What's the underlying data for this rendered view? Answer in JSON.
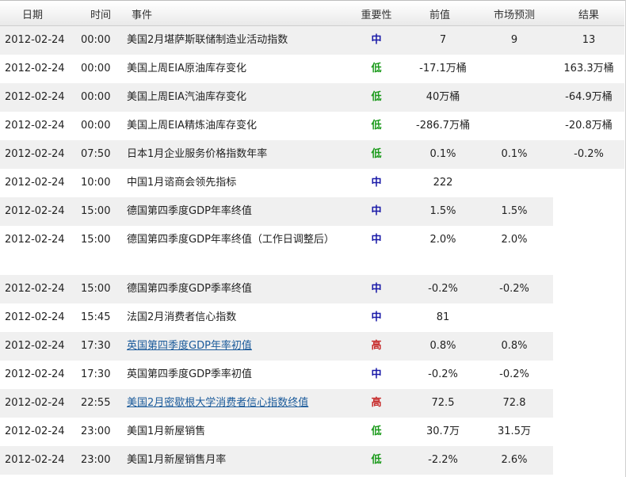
{
  "headers": {
    "date": "日期",
    "time": "时间",
    "event": "事件",
    "importance": "重要性",
    "previous": "前值",
    "forecast": "市场预测",
    "result": "结果"
  },
  "colors": {
    "importance_medium": "#1a1aa8",
    "importance_low": "#1a9a1a",
    "importance_high": "#c62828",
    "link": "#1a5a9a"
  },
  "rows": [
    {
      "date": "2012-02-24",
      "time": "00:00",
      "event": "美国2月堪萨斯联储制造业活动指数",
      "importance": "中",
      "previous": "7",
      "forecast": "9",
      "result": "13"
    },
    {
      "date": "2012-02-24",
      "time": "00:00",
      "event": "美国上周EIA原油库存变化",
      "importance": "低",
      "previous": "-17.1万桶",
      "forecast": "",
      "result": "163.3万桶"
    },
    {
      "date": "2012-02-24",
      "time": "00:00",
      "event": "美国上周EIA汽油库存变化",
      "importance": "低",
      "previous": "40万桶",
      "forecast": "",
      "result": "-64.9万桶"
    },
    {
      "date": "2012-02-24",
      "time": "00:00",
      "event": "美国上周EIA精炼油库存变化",
      "importance": "低",
      "previous": "-286.7万桶",
      "forecast": "",
      "result": "-20.8万桶"
    },
    {
      "date": "2012-02-24",
      "time": "07:50",
      "event": "日本1月企业服务价格指数年率",
      "importance": "低",
      "previous": "0.1%",
      "forecast": "0.1%",
      "result": "-0.2%"
    },
    {
      "date": "2012-02-24",
      "time": "10:00",
      "event": "中国1月谘商会领先指标",
      "importance": "中",
      "previous": "222",
      "forecast": "",
      "result": ""
    },
    {
      "date": "2012-02-24",
      "time": "15:00",
      "event": "德国第四季度GDP年率终值",
      "importance": "中",
      "previous": "1.5%",
      "forecast": "1.5%",
      "result": ""
    },
    {
      "date": "2012-02-24",
      "time": "15:00",
      "event": "德国第四季度GDP年率终值（工作日调整后）",
      "importance": "中",
      "previous": "2.0%",
      "forecast": "2.0%",
      "result": ""
    },
    {
      "date": "2012-02-24",
      "time": "15:00",
      "event": "德国第四季度GDP季率终值",
      "importance": "中",
      "previous": "-0.2%",
      "forecast": "-0.2%",
      "result": ""
    },
    {
      "date": "2012-02-24",
      "time": "15:45",
      "event": "法国2月消费者信心指数",
      "importance": "中",
      "previous": "81",
      "forecast": "",
      "result": ""
    },
    {
      "date": "2012-02-24",
      "time": "17:30",
      "event": "英国第四季度GDP年率初值",
      "importance": "高",
      "previous": "0.8%",
      "forecast": "0.8%",
      "result": ""
    },
    {
      "date": "2012-02-24",
      "time": "17:30",
      "event": "英国第四季度GDP季率初值",
      "importance": "中",
      "previous": "-0.2%",
      "forecast": "-0.2%",
      "result": ""
    },
    {
      "date": "2012-02-24",
      "time": "22:55",
      "event": "美国2月密歇根大学消费者信心指数终值",
      "importance": "高",
      "previous": "72.5",
      "forecast": "72.8",
      "result": ""
    },
    {
      "date": "2012-02-24",
      "time": "23:00",
      "event": "美国1月新屋销售",
      "importance": "低",
      "previous": "30.7万",
      "forecast": "31.5万",
      "result": ""
    },
    {
      "date": "2012-02-24",
      "time": "23:00",
      "event": "美国1月新屋销售月率",
      "importance": "低",
      "previous": "-2.2%",
      "forecast": "2.6%",
      "result": ""
    }
  ]
}
